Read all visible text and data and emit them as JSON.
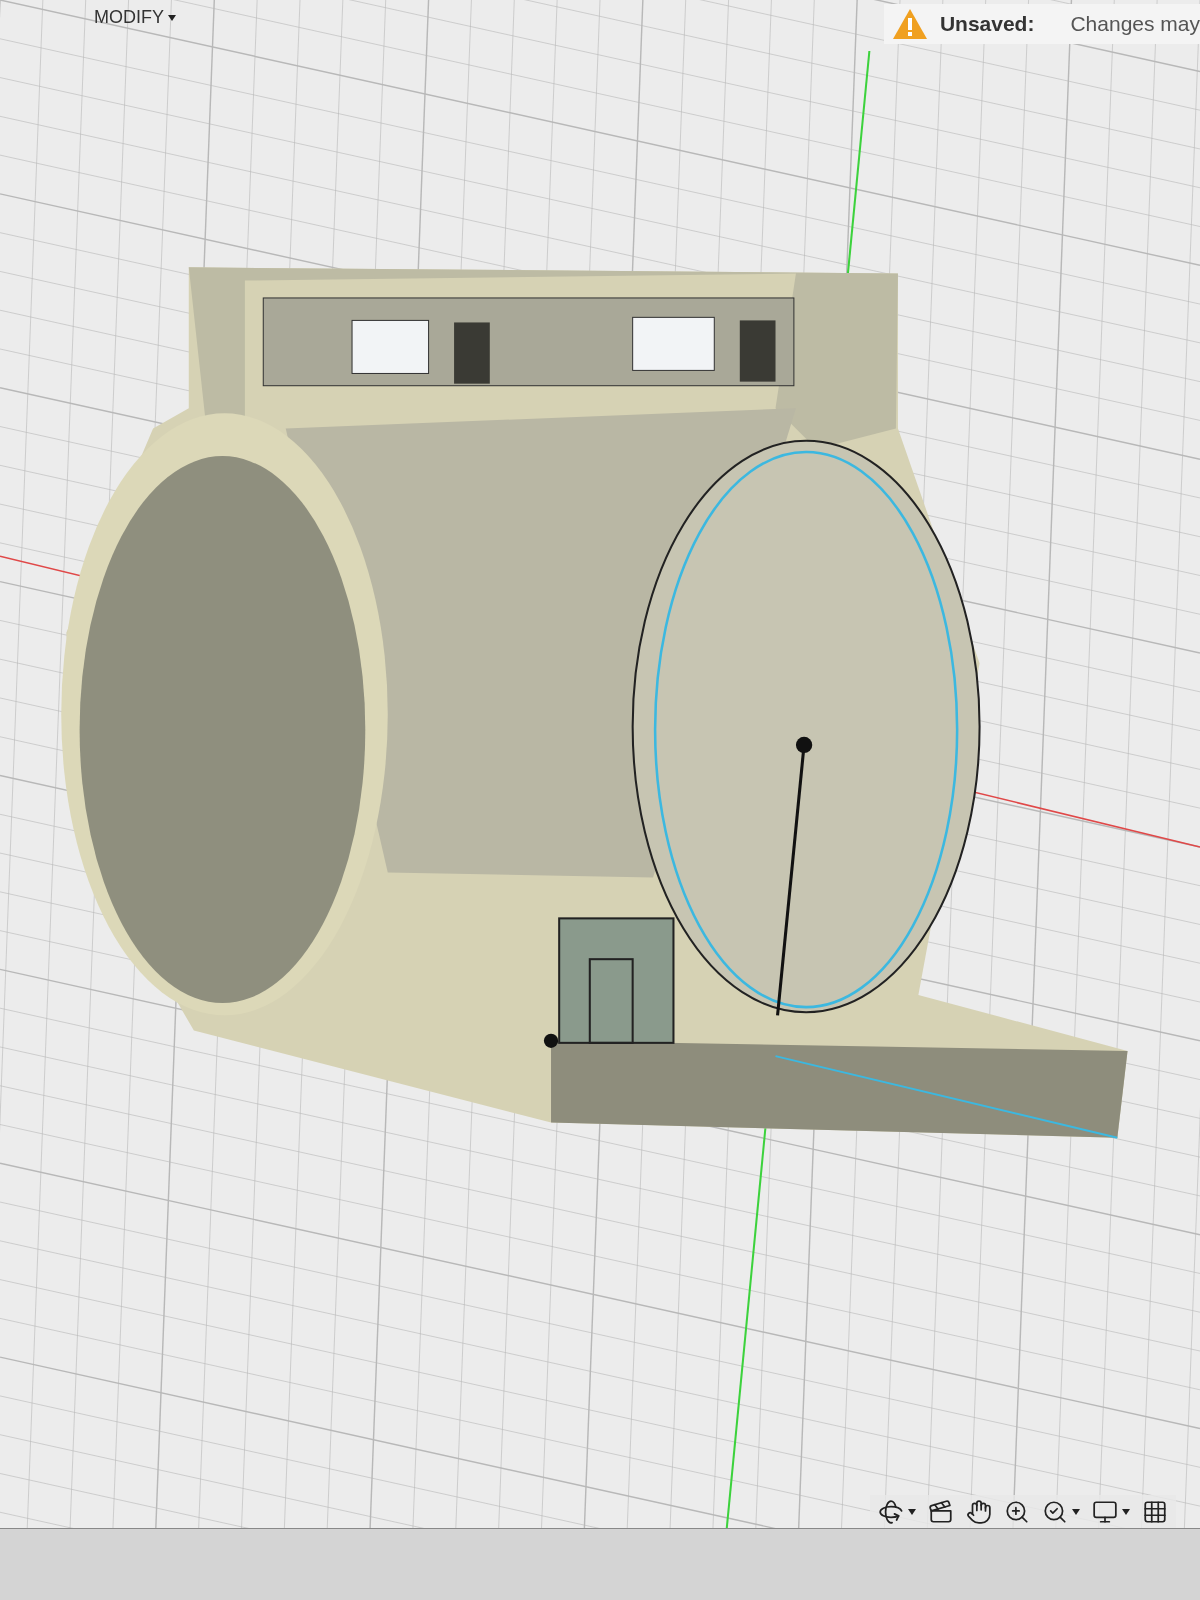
{
  "toolbar": {
    "menu": {
      "label": "MODIFY",
      "dropdown": true
    }
  },
  "notice": {
    "label": "Unsaved:",
    "message": "Changes may"
  },
  "nav_bar": {
    "tools": [
      {
        "kind": "orbit",
        "dropdown": true
      },
      {
        "kind": "look_at",
        "dropdown": false
      },
      {
        "kind": "pan",
        "dropdown": false
      },
      {
        "kind": "zoom",
        "dropdown": false
      },
      {
        "kind": "fit",
        "dropdown": true
      },
      {
        "kind": "display",
        "dropdown": true
      },
      {
        "kind": "grid",
        "dropdown": false
      }
    ]
  }
}
